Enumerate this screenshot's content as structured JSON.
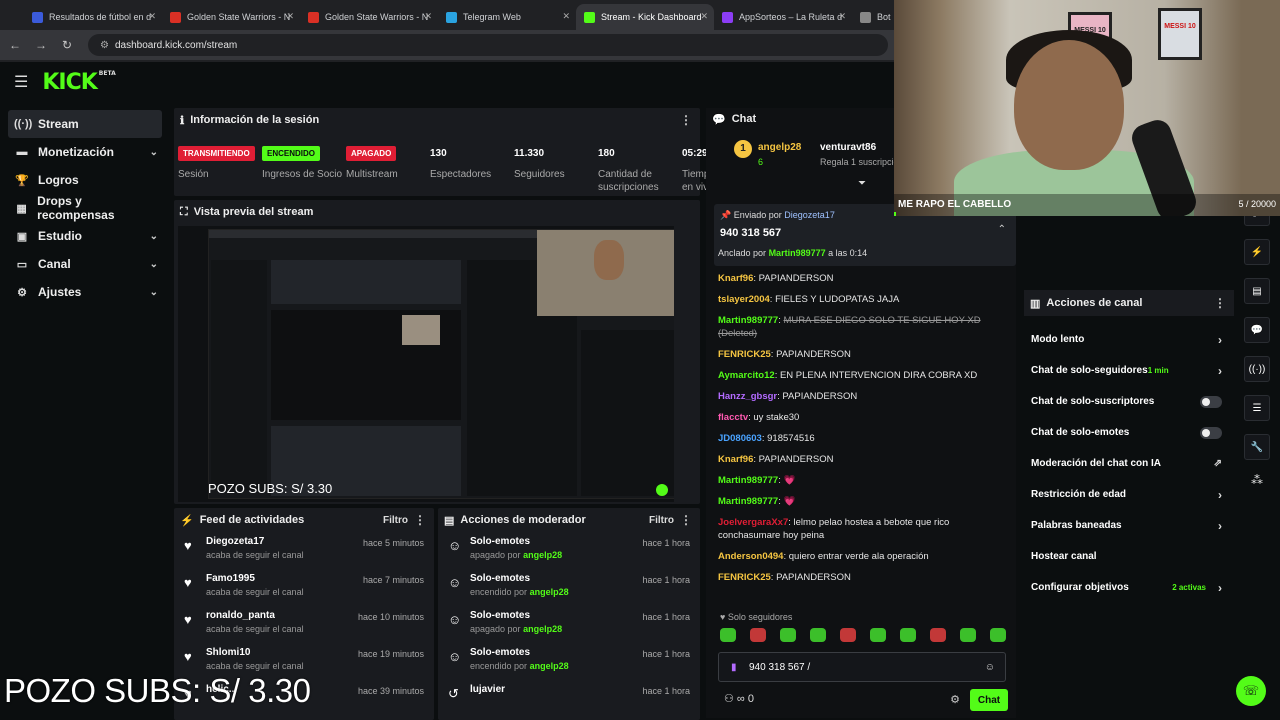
{
  "browser": {
    "tabs": [
      {
        "title": "Resultados de fútbol en d",
        "color": "#3b5bdb"
      },
      {
        "title": "Golden State Warriors - N",
        "color": "#d93025"
      },
      {
        "title": "Golden State Warriors - N",
        "color": "#d93025"
      },
      {
        "title": "Telegram Web",
        "color": "#2aa3e0"
      },
      {
        "title": "Stream - Kick Dashboard",
        "color": "#53fc18"
      },
      {
        "title": "AppSorteos – La Ruleta d",
        "color": "#8b3df5"
      },
      {
        "title": "Bot",
        "color": "#888888"
      }
    ],
    "url": "dashboard.kick.com/stream"
  },
  "app": {
    "logo": "KICK",
    "logo_beta": "BETA",
    "accent": "#53fc18"
  },
  "sidebar": {
    "items": [
      {
        "label": "Stream",
        "icon": "stream-icon",
        "glyph": "((·))"
      },
      {
        "label": "Monetización",
        "icon": "money-icon",
        "glyph": "▬"
      },
      {
        "label": "Logros",
        "icon": "trophy-icon",
        "glyph": "🏆"
      },
      {
        "label": "Drops y recompensas",
        "icon": "gift-icon",
        "glyph": "▦"
      },
      {
        "label": "Estudio",
        "icon": "studio-icon",
        "glyph": "▣"
      },
      {
        "label": "Canal",
        "icon": "channel-icon",
        "glyph": "▭"
      },
      {
        "label": "Ajustes",
        "icon": "gear-icon",
        "glyph": "⚙"
      }
    ]
  },
  "session": {
    "title": "Información de la sesión",
    "stats": [
      {
        "value": "TRANSMITIENDO",
        "label": "Sesión",
        "kind": "red"
      },
      {
        "value": "ENCENDIDO",
        "label": "Ingresos de Socio",
        "kind": "green"
      },
      {
        "value": "APAGADO",
        "label": "Multistream",
        "kind": "red"
      },
      {
        "value": "130",
        "label": "Espectadores",
        "kind": "num"
      },
      {
        "value": "11.330",
        "label": "Seguidores",
        "kind": "num"
      },
      {
        "value": "180",
        "label": "Cantidad de suscripciones",
        "kind": "num"
      },
      {
        "value": "05:29:",
        "label": "Tiempo en vivo",
        "kind": "num"
      }
    ]
  },
  "preview": {
    "title": "Vista previa del stream",
    "overlay": "POZO SUBS: S/ 3.30"
  },
  "overlay_big": "POZO SUBS: S/ 3.30",
  "feed": {
    "title": "Feed de actividades",
    "filter": "Filtro",
    "items": [
      {
        "name": "Diegozeta17",
        "sub": "acaba de seguir el canal",
        "time": "hace 5 minutos"
      },
      {
        "name": "Famo1995",
        "sub": "acaba de seguir el canal",
        "time": "hace 7 minutos"
      },
      {
        "name": "ronaldo_panta",
        "sub": "acaba de seguir el canal",
        "time": "hace 10 minutos"
      },
      {
        "name": "Shlomi10",
        "sub": "acaba de seguir el canal",
        "time": "hace 19 minutos"
      },
      {
        "name": "helic...",
        "sub": "",
        "time": "hace 39 minutos"
      }
    ]
  },
  "mod": {
    "title": "Acciones de moderador",
    "filter": "Filtro",
    "items": [
      {
        "name": "Solo-emotes",
        "state": "apagado por",
        "user": "angelp28",
        "time": "hace 1 hora"
      },
      {
        "name": "Solo-emotes",
        "state": "encendido por",
        "user": "angelp28",
        "time": "hace 1 hora"
      },
      {
        "name": "Solo-emotes",
        "state": "apagado por",
        "user": "angelp28",
        "time": "hace 1 hora"
      },
      {
        "name": "Solo-emotes",
        "state": "encendido por",
        "user": "angelp28",
        "time": "hace 1 hora"
      },
      {
        "name": "lujavier",
        "state": "",
        "user": "",
        "time": "hace 1 hora"
      }
    ]
  },
  "chat": {
    "title": "Chat",
    "top_user": "angelp28",
    "top_count": "6",
    "top_user2": "venturavt86",
    "top_sub": "Regala 1 suscripció",
    "pinned_by_label": "Enviado por",
    "pinned_by": "Diegozeta17",
    "pinned_text": "940 318 567",
    "anchored_label": "Anclado por",
    "anchored_user": "Martin989777",
    "anchored_time": "a las 0:14",
    "messages": [
      {
        "user": "Knarf96",
        "color": "#f5c542",
        "text": "PAPIANDERSON"
      },
      {
        "user": "tslayer2004",
        "color": "#f5c542",
        "text": "FIELES Y LUDOPATAS JAJA"
      },
      {
        "user": "Martin989777",
        "color": "#53fc18",
        "text": "MURA ESE DIEGO SOLO TE SIGUE HOY XD (Deleted)"
      },
      {
        "user": "FENRICK25",
        "color": "#f5c542",
        "text": "PAPIANDERSON"
      },
      {
        "user": "Aymarcito12",
        "color": "#53fc18",
        "text": "EN PLENA INTERVENCION DIRA COBRA XD"
      },
      {
        "user": "Hanzz_gbsgr",
        "color": "#b36bff",
        "text": "PAPIANDERSON"
      },
      {
        "user": "flacctv",
        "color": "#ff5ab1",
        "text": "uy stake30"
      },
      {
        "user": "JD080603",
        "color": "#4aa3ff",
        "text": "918574516"
      },
      {
        "user": "Knarf96",
        "color": "#f5c542",
        "text": "PAPIANDERSON"
      },
      {
        "user": "Martin989777",
        "color": "#53fc18",
        "text": "💗"
      },
      {
        "user": "Martin989777",
        "color": "#53fc18",
        "text": "💗"
      },
      {
        "user": "JoelvergaraXx7",
        "color": "#e01e35",
        "text": "lelmo pelao hostea a bebote que rico conchasumare hoy peina"
      },
      {
        "user": "Anderson0494",
        "color": "#f5c542",
        "text": "quiero entrar verde ala operación"
      },
      {
        "user": "FENRICK25",
        "color": "#f5c542",
        "text": "PAPIANDERSON"
      }
    ],
    "followers_only": "Solo seguidores",
    "input_value": "940 318 567 /",
    "send_label": "Chat",
    "viewer_count": "0"
  },
  "actions": {
    "title": "Acciones de canal",
    "rows": [
      {
        "label": "Modo lento",
        "sub": "",
        "control": "chevron"
      },
      {
        "label": "Chat de solo-seguidores",
        "sub": "1 min",
        "control": "chevron"
      },
      {
        "label": "Chat de solo-suscriptores",
        "sub": "",
        "control": "toggle"
      },
      {
        "label": "Chat de solo-emotes",
        "sub": "",
        "control": "toggle"
      },
      {
        "label": "Moderación del chat con IA",
        "sub": "",
        "control": "external"
      },
      {
        "label": "Restricción de edad",
        "sub": "",
        "control": "chevron"
      },
      {
        "label": "Palabras baneadas",
        "sub": "",
        "control": "chevron"
      },
      {
        "label": "Hostear canal",
        "sub": "",
        "control": "none"
      },
      {
        "label": "Configurar objetivos",
        "sub": "2 activas",
        "control": "chevron"
      }
    ]
  },
  "webcam": {
    "goal_title": "ME RAPO EL CABELLO",
    "goal_count": "5 / 20000",
    "goal_fraction": 0.00025,
    "frame1": "MESSI 10",
    "frame2": "MESSI 10"
  }
}
